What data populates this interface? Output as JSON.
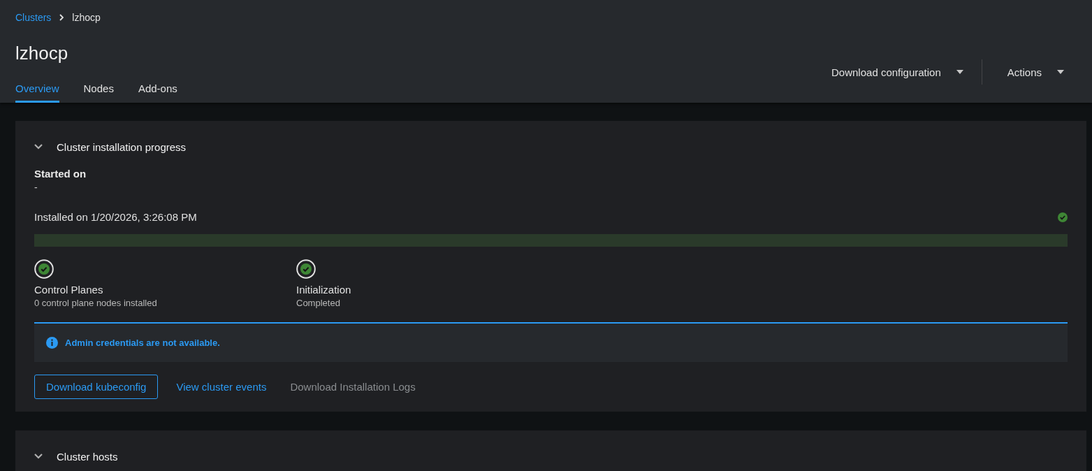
{
  "breadcrumb": [
    {
      "label": "Clusters",
      "link": true
    },
    {
      "label": "lzhocp",
      "link": false
    }
  ],
  "title": "lzhocp",
  "tabs": [
    {
      "label": "Overview",
      "selected": true
    },
    {
      "label": "Nodes",
      "selected": false
    },
    {
      "label": "Add-ons",
      "selected": false
    }
  ],
  "header_actions": [
    "Download configuration",
    "Actions"
  ],
  "install_card": {
    "title": "Cluster installation progress",
    "expanded": true,
    "started_label": "Started on",
    "started_value": "-",
    "installed_text": "Installed on 1/20/2026, 3:26:08 PM",
    "complete": true,
    "progress": {
      "level": 1
    },
    "steps": [
      {
        "name": "Control Planes",
        "detail": "0 control plane nodes installed",
        "complete": true
      },
      {
        "name": "Initialization",
        "detail": "Completed",
        "complete": true
      }
    ],
    "alert": {
      "kind": "info",
      "text": "Admin credentials are not available."
    },
    "actions": [
      {
        "label": "Download kubeconfig",
        "kind": "secondary",
        "disabled": false
      },
      {
        "label": "View cluster events",
        "kind": "link",
        "disabled": false
      },
      {
        "label": "Download Installation Logs",
        "kind": "link",
        "disabled": true
      }
    ]
  },
  "hosts_card": {
    "title": "Cluster hosts",
    "expanded": true
  }
}
